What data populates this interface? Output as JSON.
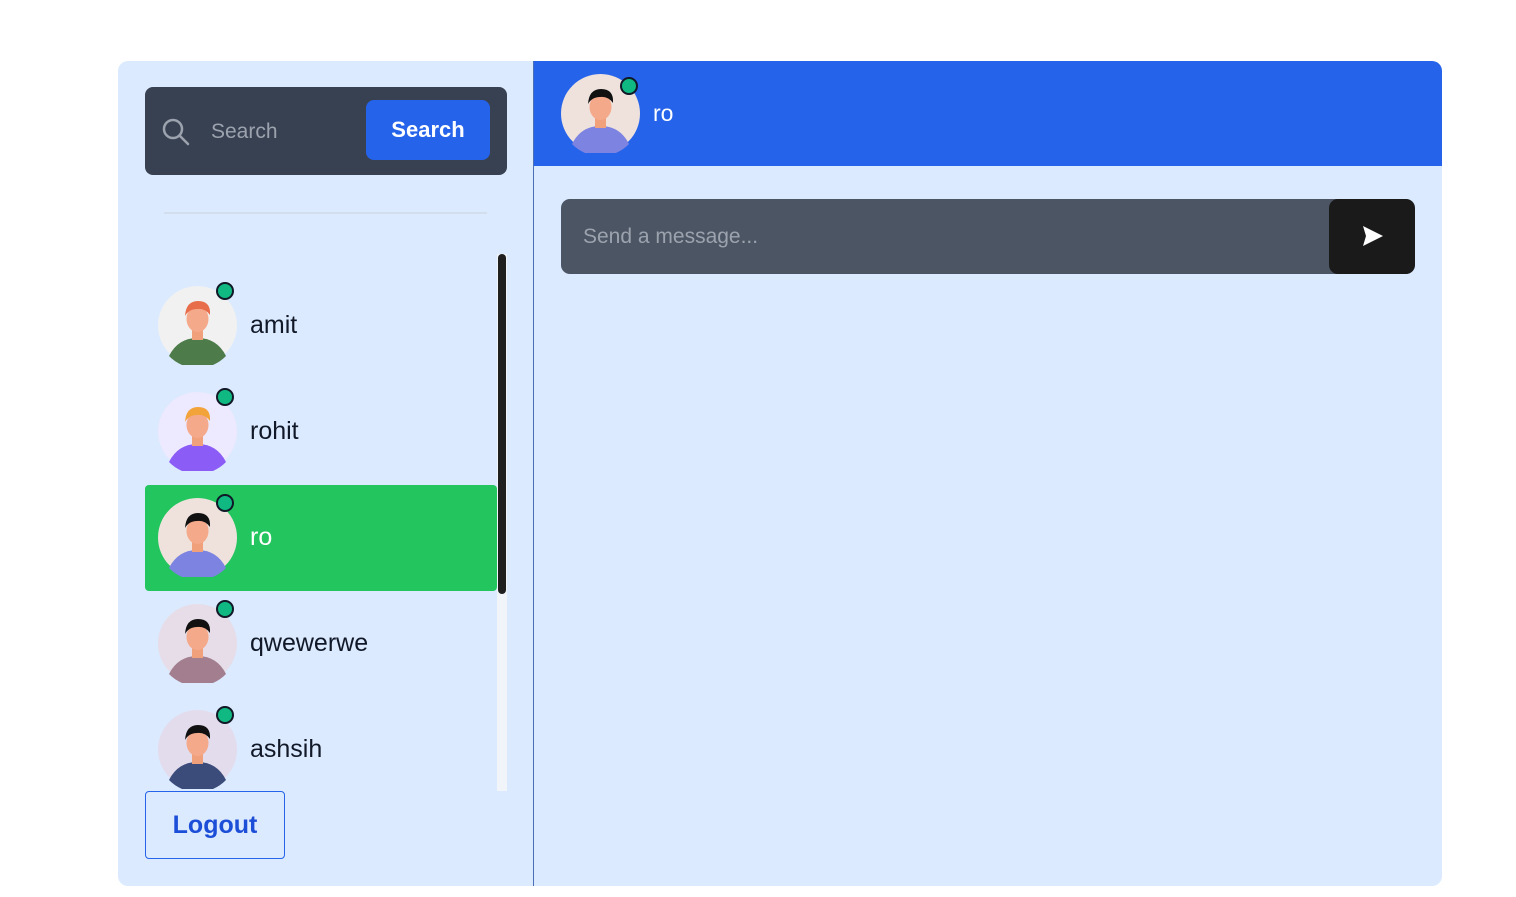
{
  "sidebar": {
    "search": {
      "placeholder": "Search",
      "button_label": "Search"
    },
    "conversations": [
      {
        "name": "amit",
        "online": true,
        "avatar_bg": "#f1f1f1",
        "shirt": "#4d7c4a",
        "hair": "#e86d4a",
        "active": false
      },
      {
        "name": "rohit",
        "online": true,
        "avatar_bg": "#ede9fe",
        "shirt": "#8b5cf6",
        "hair": "#f2a33a",
        "active": false
      },
      {
        "name": "ro",
        "online": true,
        "avatar_bg": "#efe2dc",
        "shirt": "#7c83e0",
        "hair": "#111111",
        "active": true
      },
      {
        "name": "qwewerwe",
        "online": true,
        "avatar_bg": "#e6dde8",
        "shirt": "#a27e8e",
        "hair": "#111111",
        "active": false
      },
      {
        "name": "ashsih",
        "online": true,
        "avatar_bg": "#e3dced",
        "shirt": "#3c4c7a",
        "hair": "#111111",
        "active": false
      }
    ],
    "logout_label": "Logout"
  },
  "chat": {
    "header_name": "ro",
    "message_placeholder": "Send a message..."
  },
  "colors": {
    "accent": "#2563eb",
    "active_item": "#22c55e",
    "online_dot": "#10b981"
  }
}
